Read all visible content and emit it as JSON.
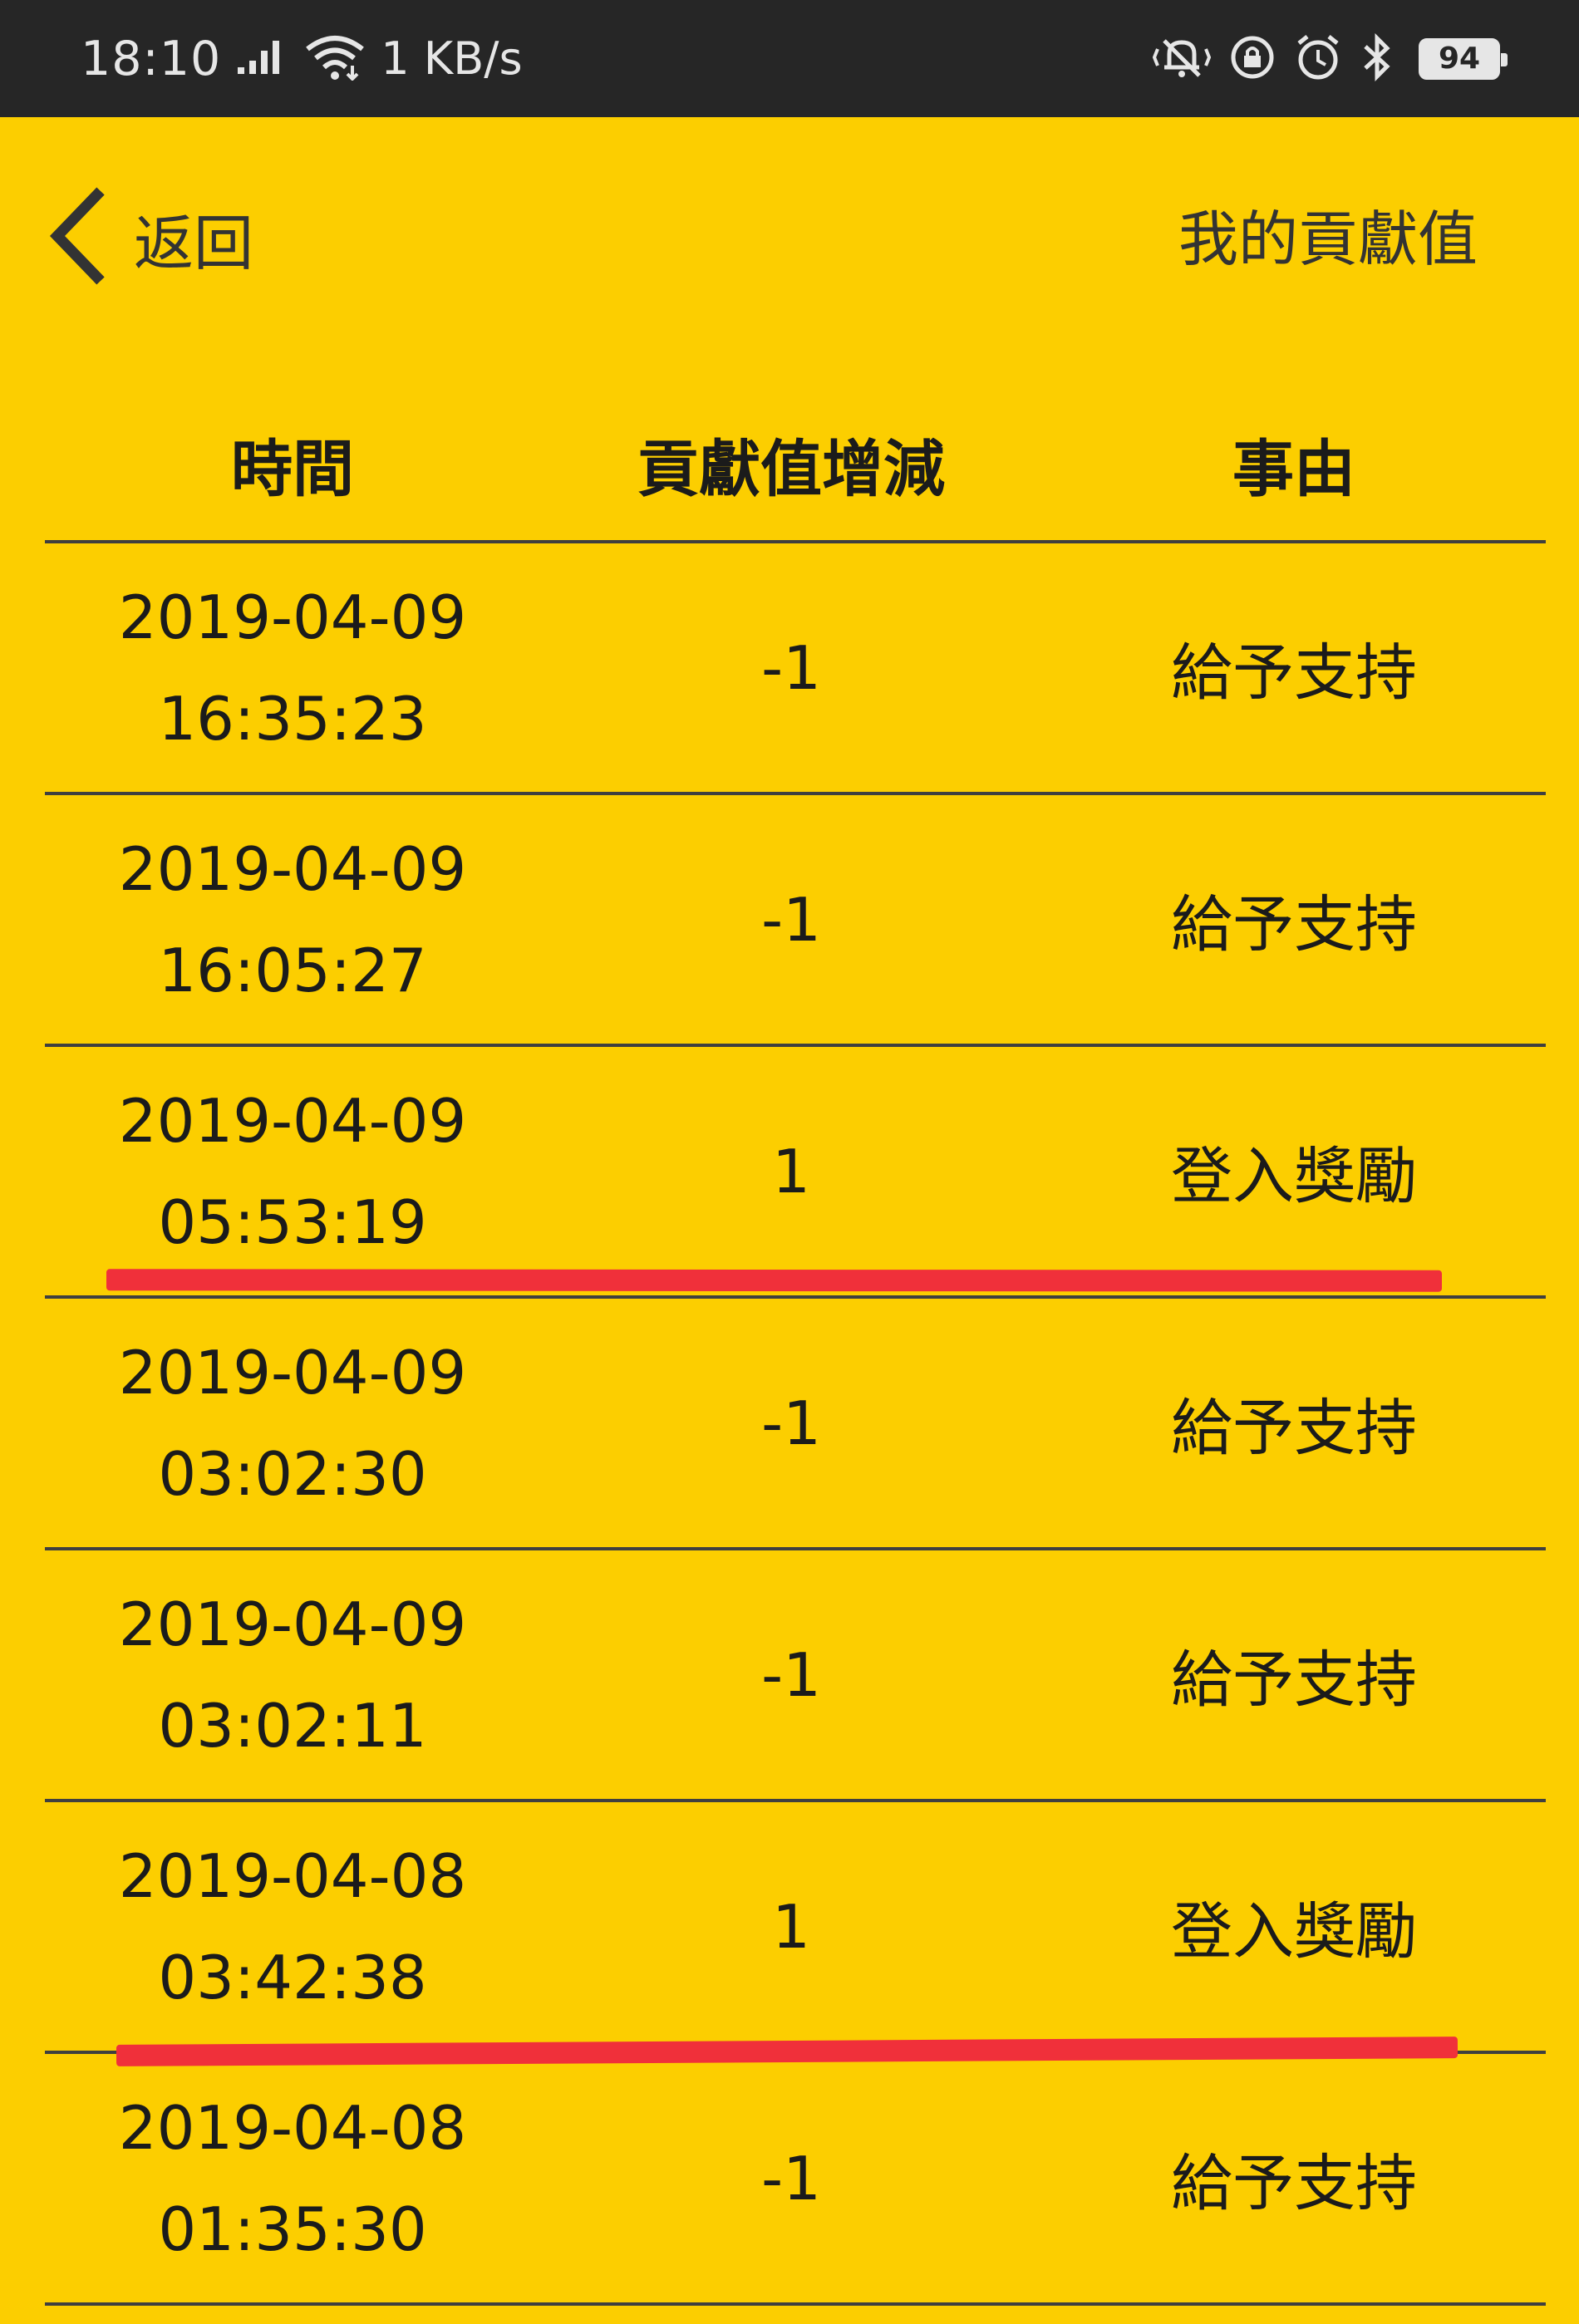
{
  "status_bar": {
    "time": "18:10",
    "speed": "1 KB/s",
    "battery": "94",
    "icons": [
      "signal-icon",
      "wifi-icon",
      "vibrate-icon",
      "rotation-lock-icon",
      "alarm-icon",
      "bluetooth-icon",
      "battery-icon"
    ]
  },
  "nav": {
    "back_label": "返回",
    "title": "我的貢獻值"
  },
  "table": {
    "headers": {
      "time": "時間",
      "delta": "貢獻值增減",
      "reason": "事由"
    },
    "rows": [
      {
        "date": "2019-04-09",
        "time": "16:35:23",
        "delta": "-1",
        "reason": "給予支持"
      },
      {
        "date": "2019-04-09",
        "time": "16:05:27",
        "delta": "-1",
        "reason": "給予支持"
      },
      {
        "date": "2019-04-09",
        "time": "05:53:19",
        "delta": "1",
        "reason": "登入獎勵"
      },
      {
        "date": "2019-04-09",
        "time": "03:02:30",
        "delta": "-1",
        "reason": "給予支持"
      },
      {
        "date": "2019-04-09",
        "time": "03:02:11",
        "delta": "-1",
        "reason": "給予支持"
      },
      {
        "date": "2019-04-08",
        "time": "03:42:38",
        "delta": "1",
        "reason": "登入獎勵"
      },
      {
        "date": "2019-04-08",
        "time": "01:35:30",
        "delta": "-1",
        "reason": "給予支持"
      }
    ]
  },
  "colors": {
    "background": "#FCCE00",
    "status_bar": "#262626",
    "highlight": "#F0303A"
  }
}
